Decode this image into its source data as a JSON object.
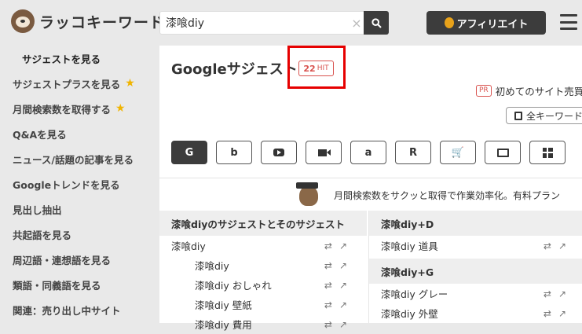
{
  "header": {
    "logo_text": "ラッコキーワード",
    "search_value": "漆喰diy",
    "affiliate_label": "アフィリエイト"
  },
  "sidebar": {
    "items": [
      {
        "label": "サジェストを見る",
        "active": true,
        "star": false
      },
      {
        "label": "サジェストプラスを見る",
        "star": true
      },
      {
        "label": "月間検索数を取得する",
        "star": true
      },
      {
        "label": "Q&Aを見る",
        "star": false
      },
      {
        "label": "ニュース/話題の記事を見る",
        "star": false
      },
      {
        "label": "Googleトレンドを見る",
        "star": false
      },
      {
        "label": "見出し抽出",
        "star": false
      },
      {
        "label": "共起語を見る",
        "star": false
      },
      {
        "label": "周辺語・連想語を見る",
        "star": false
      },
      {
        "label": "類語・同義語を見る",
        "star": false
      },
      {
        "label": "関連：売り出し中サイト",
        "star": false
      }
    ]
  },
  "main": {
    "title": "Googleサジェスト",
    "hit_count": "22",
    "hit_unit": "HIT",
    "pr_tag": "PR",
    "pr_text": "初めてのサイト売買",
    "copy_label": "全キーワード",
    "engines": [
      {
        "name": "google",
        "glyph": "G",
        "active": true
      },
      {
        "name": "bing",
        "glyph": "b",
        "active": false
      },
      {
        "name": "youtube",
        "glyph": "",
        "active": false
      },
      {
        "name": "video",
        "glyph": "",
        "active": false
      },
      {
        "name": "amazon",
        "glyph": "a",
        "active": false
      },
      {
        "name": "rakuten",
        "glyph": "R",
        "active": false
      },
      {
        "name": "shopping",
        "glyph": "🛒",
        "active": false
      },
      {
        "name": "image",
        "glyph": "",
        "active": false
      },
      {
        "name": "apps",
        "glyph": "",
        "active": false
      }
    ],
    "promo_text": "月間検索数をサクッと取得で作業効率化。有料プラン",
    "left_column": {
      "header": "漆喰diyのサジェストとそのサジェスト",
      "rows": [
        {
          "kw": "漆喰diy",
          "child": false
        },
        {
          "kw": "漆喰diy",
          "child": true
        },
        {
          "kw": "漆喰diy おしゃれ",
          "child": true
        },
        {
          "kw": "漆喰diy 壁紙",
          "child": true
        },
        {
          "kw": "漆喰diy 費用",
          "child": true
        }
      ]
    },
    "right_column": {
      "groups": [
        {
          "header": "漆喰diy+D",
          "rows": [
            "漆喰diy 道具"
          ]
        },
        {
          "header": "漆喰diy+G",
          "rows": [
            "漆喰diy グレー",
            "漆喰diy 外壁"
          ]
        }
      ]
    }
  }
}
